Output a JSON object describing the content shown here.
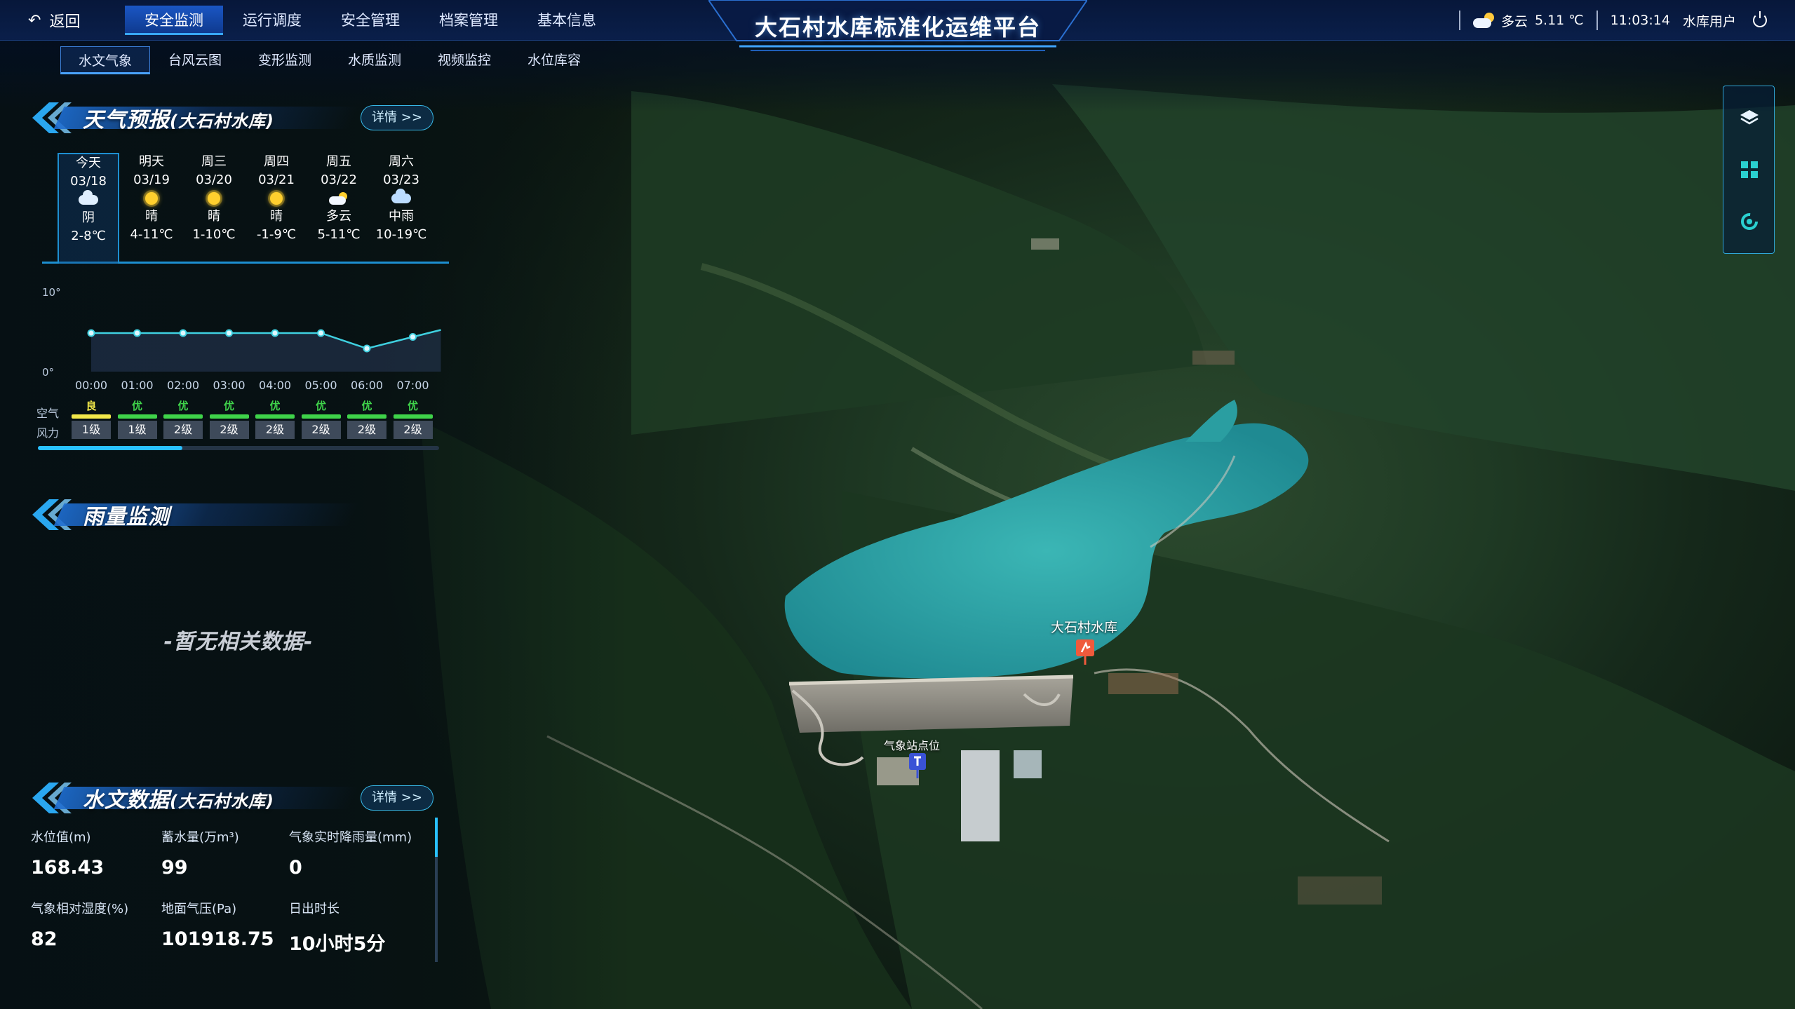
{
  "topbar": {
    "back_label": "返回",
    "nav": [
      "安全监测",
      "运行调度",
      "安全管理",
      "档案管理",
      "基本信息"
    ],
    "active_nav": 0,
    "title": "大石村水库标准化运维平台",
    "weather_text": "多云",
    "temperature": "5.11 ℃",
    "time": "11:03:14",
    "user": "水库用户"
  },
  "subnav": {
    "items": [
      "水文气象",
      "台风云图",
      "变形监测",
      "水质监测",
      "视频监控",
      "水位库容"
    ],
    "active": 0
  },
  "weather": {
    "title": "天气预报",
    "subtitle": "(大石村水库)",
    "detail": "详情 >>",
    "days": [
      {
        "name": "今天",
        "date": "03/18",
        "icon": "cloudy-icon",
        "cond": "阴",
        "temp": "2-8℃"
      },
      {
        "name": "明天",
        "date": "03/19",
        "icon": "sunny-icon",
        "cond": "晴",
        "temp": "4-11℃"
      },
      {
        "name": "周三",
        "date": "03/20",
        "icon": "sunny-icon",
        "cond": "晴",
        "temp": "1-10℃"
      },
      {
        "name": "周四",
        "date": "03/21",
        "icon": "sunny-icon",
        "cond": "晴",
        "temp": "-1-9℃"
      },
      {
        "name": "周五",
        "date": "03/22",
        "icon": "partly-cloudy-icon",
        "cond": "多云",
        "temp": "5-11℃"
      },
      {
        "name": "周六",
        "date": "03/23",
        "icon": "rain-icon",
        "cond": "中雨",
        "temp": "10-19℃"
      }
    ]
  },
  "hourly": {
    "y_top": "10°",
    "y_bottom": "0°",
    "times": [
      "00:00",
      "01:00",
      "02:00",
      "03:00",
      "04:00",
      "05:00",
      "06:00",
      "07:00"
    ],
    "temps": [
      5,
      5,
      5,
      5,
      5,
      5,
      3,
      4.5
    ],
    "temp_range": [
      0,
      10
    ],
    "air_label": "空气",
    "air": [
      "良",
      "优",
      "优",
      "优",
      "优",
      "优",
      "优",
      "优"
    ],
    "air_colors": {
      "良": "#f2e84a",
      "优": "#3fd34a"
    },
    "wind_label": "风力",
    "wind": [
      "1级",
      "1级",
      "2级",
      "2级",
      "2级",
      "2级",
      "2级",
      "2级"
    ],
    "scroll_fraction": 0.36
  },
  "rain": {
    "title": "雨量监测",
    "empty": "-暂无相关数据-"
  },
  "hydro": {
    "title": "水文数据",
    "subtitle": "(大石村水库)",
    "detail": "详情 >>",
    "items": [
      {
        "label": "水位值(m)",
        "value": "168.43"
      },
      {
        "label": "蓄水量(万m³)",
        "value": "99"
      },
      {
        "label": "气象实时降雨量(mm)",
        "value": "0"
      },
      {
        "label": "气象相对湿度(%)",
        "value": "82"
      },
      {
        "label": "地面气压(Pa)",
        "value": "101918.75"
      },
      {
        "label": "日出时长",
        "value": "10小时5分"
      }
    ]
  },
  "map": {
    "reservoir_label": "大石村水库",
    "station_label": "气象站点位",
    "water_color": "#2fa6a8"
  },
  "colors": {
    "accent": "#29c0ff",
    "nav_bg": "#07173a",
    "nav_active": "#1a56c4"
  }
}
